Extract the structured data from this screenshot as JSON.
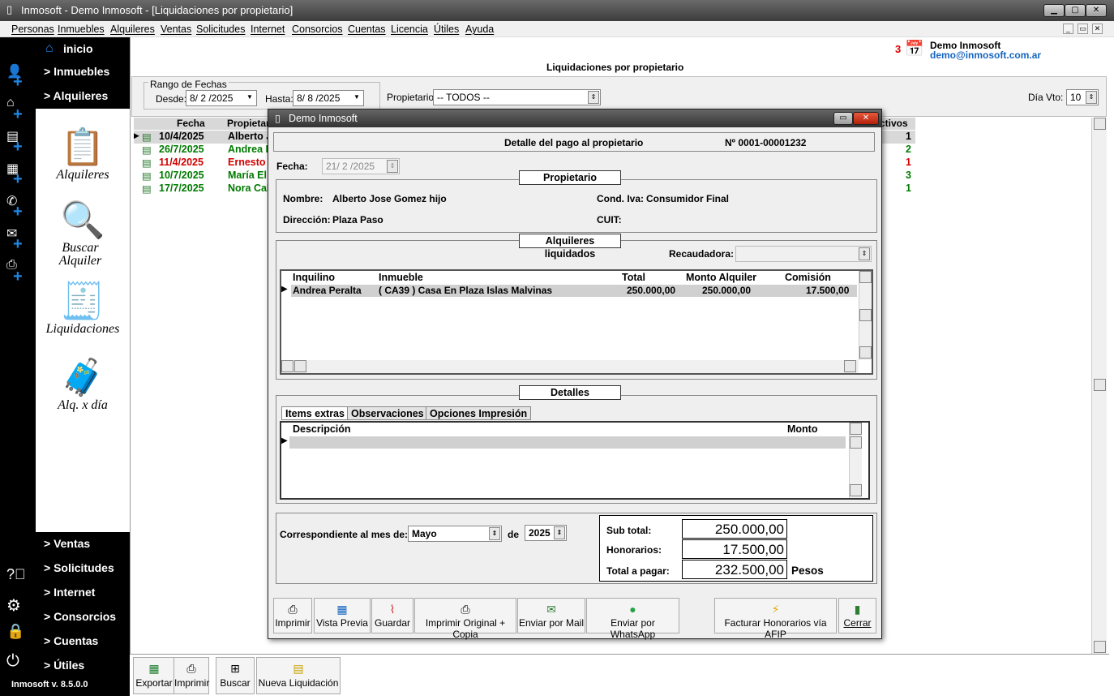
{
  "window": {
    "title": "Inmosoft - Demo Inmosoft - [Liquidaciones por propietario]",
    "controls": [
      "▁",
      "▢",
      "✕"
    ]
  },
  "menu": [
    "Personas",
    "Inmuebles",
    "Alquileres",
    "Ventas",
    "Solicitudes",
    "Internet",
    "Consorcios",
    "Cuentas",
    "Licencia",
    "Útiles",
    "Ayuda"
  ],
  "nav": {
    "top": [
      ">  inicio",
      "> Inmuebles",
      "> Alquileres"
    ],
    "bottom": [
      "> Ventas",
      "> Solicitudes",
      "> Internet",
      "> Consorcios",
      "> Cuentas",
      "> Útiles"
    ],
    "inicio": "inicio"
  },
  "icons": [
    {
      "label": "Alquileres",
      "icon": "contract-house-icon"
    },
    {
      "label": "Buscar Alquiler",
      "icon": "magnifier-house-icon"
    },
    {
      "label": "Liquidaciones",
      "icon": "invoice-house-icon"
    },
    {
      "label": "Alq. x día",
      "icon": "tourist-icon"
    }
  ],
  "version": "Inmosoft v. 8.5.0.0",
  "header": {
    "notif_count": "3",
    "user": "Demo Inmosoft",
    "email": "demo@inmosoft.com.ar",
    "title": "Liquidaciones por propietario"
  },
  "filters": {
    "range_label": "Rango de Fechas",
    "desde_label": "Desde:",
    "desde": "8/ 2 /2025",
    "hasta_label": "Hasta:",
    "hasta": "8/ 8 /2025",
    "propietario_label": "Propietario:",
    "propietario": "-- TODOS --",
    "diavto_label": "Día Vto:",
    "diavto": "10"
  },
  "list": {
    "headers": [
      "Fecha",
      "Propietar",
      "ctivos"
    ],
    "rows": [
      {
        "fecha": "10/4/2025",
        "prop": "Alberto J",
        "n": "1",
        "color": "#000000"
      },
      {
        "fecha": "26/7/2025",
        "prop": "Andrea F",
        "n": "2",
        "color": "#007a00"
      },
      {
        "fecha": "11/4/2025",
        "prop": "Ernesto",
        "n": "1",
        "color": "#d00000"
      },
      {
        "fecha": "10/7/2025",
        "prop": "María El",
        "n": "3",
        "color": "#007a00"
      },
      {
        "fecha": "17/7/2025",
        "prop": "Nora Cal",
        "n": "1",
        "color": "#007a00"
      }
    ]
  },
  "toolbar": [
    "Exportar",
    "Imprimir",
    "Buscar",
    "Nueva Liquidación"
  ],
  "dialog": {
    "title": "Demo Inmosoft",
    "heading": "Detalle del pago al propietario",
    "numero": "Nº  0001-00001232",
    "fecha_label": "Fecha:",
    "fecha": "21/ 2 /2025",
    "prop_legend": "Propietario",
    "nombre_label": "Nombre:",
    "nombre": "Alberto Jose Gomez hijo",
    "iva_label": "Cond. Iva:",
    "iva": "Consumidor Final",
    "dir_label": "Dirección:",
    "dir": "Plaza Paso",
    "cuit_label": "CUIT:",
    "alq_legend": "Alquileres liquidados",
    "recaud_label": "Recaudadora:",
    "alq_headers": [
      "Inquilino",
      "Inmueble",
      "Total",
      "Monto Alquiler",
      "Comisión"
    ],
    "alq_row": {
      "inquilino": "Andrea Peralta",
      "inmueble": "( CA39  ) Casa En Plaza Islas Malvinas",
      "total": "250.000,00",
      "monto": "250.000,00",
      "comision": "17.500,00"
    },
    "det_legend": "Detalles",
    "tabs": [
      "Items extras",
      "Observaciones",
      "Opciones Impresión"
    ],
    "det_headers": [
      "Descripción",
      "Monto"
    ],
    "mes_label": "Correspondiente al mes de:",
    "mes": "Mayo",
    "de_label": "de",
    "anio": "2025",
    "subtotal_label": "Sub total:",
    "subtotal": "250.000,00",
    "hon_label": "Honorarios:",
    "hon": "17.500,00",
    "total_label": "Total a pagar:",
    "total": "232.500,00",
    "pesos": "Pesos",
    "buttons": [
      "Imprimir",
      "Vista Previa",
      "Guardar",
      "Imprimir Original + Copia",
      "Enviar por Mail",
      "Enviar por WhatsApp",
      "Facturar Honorarios vía AFIP",
      "Cerrar"
    ]
  }
}
